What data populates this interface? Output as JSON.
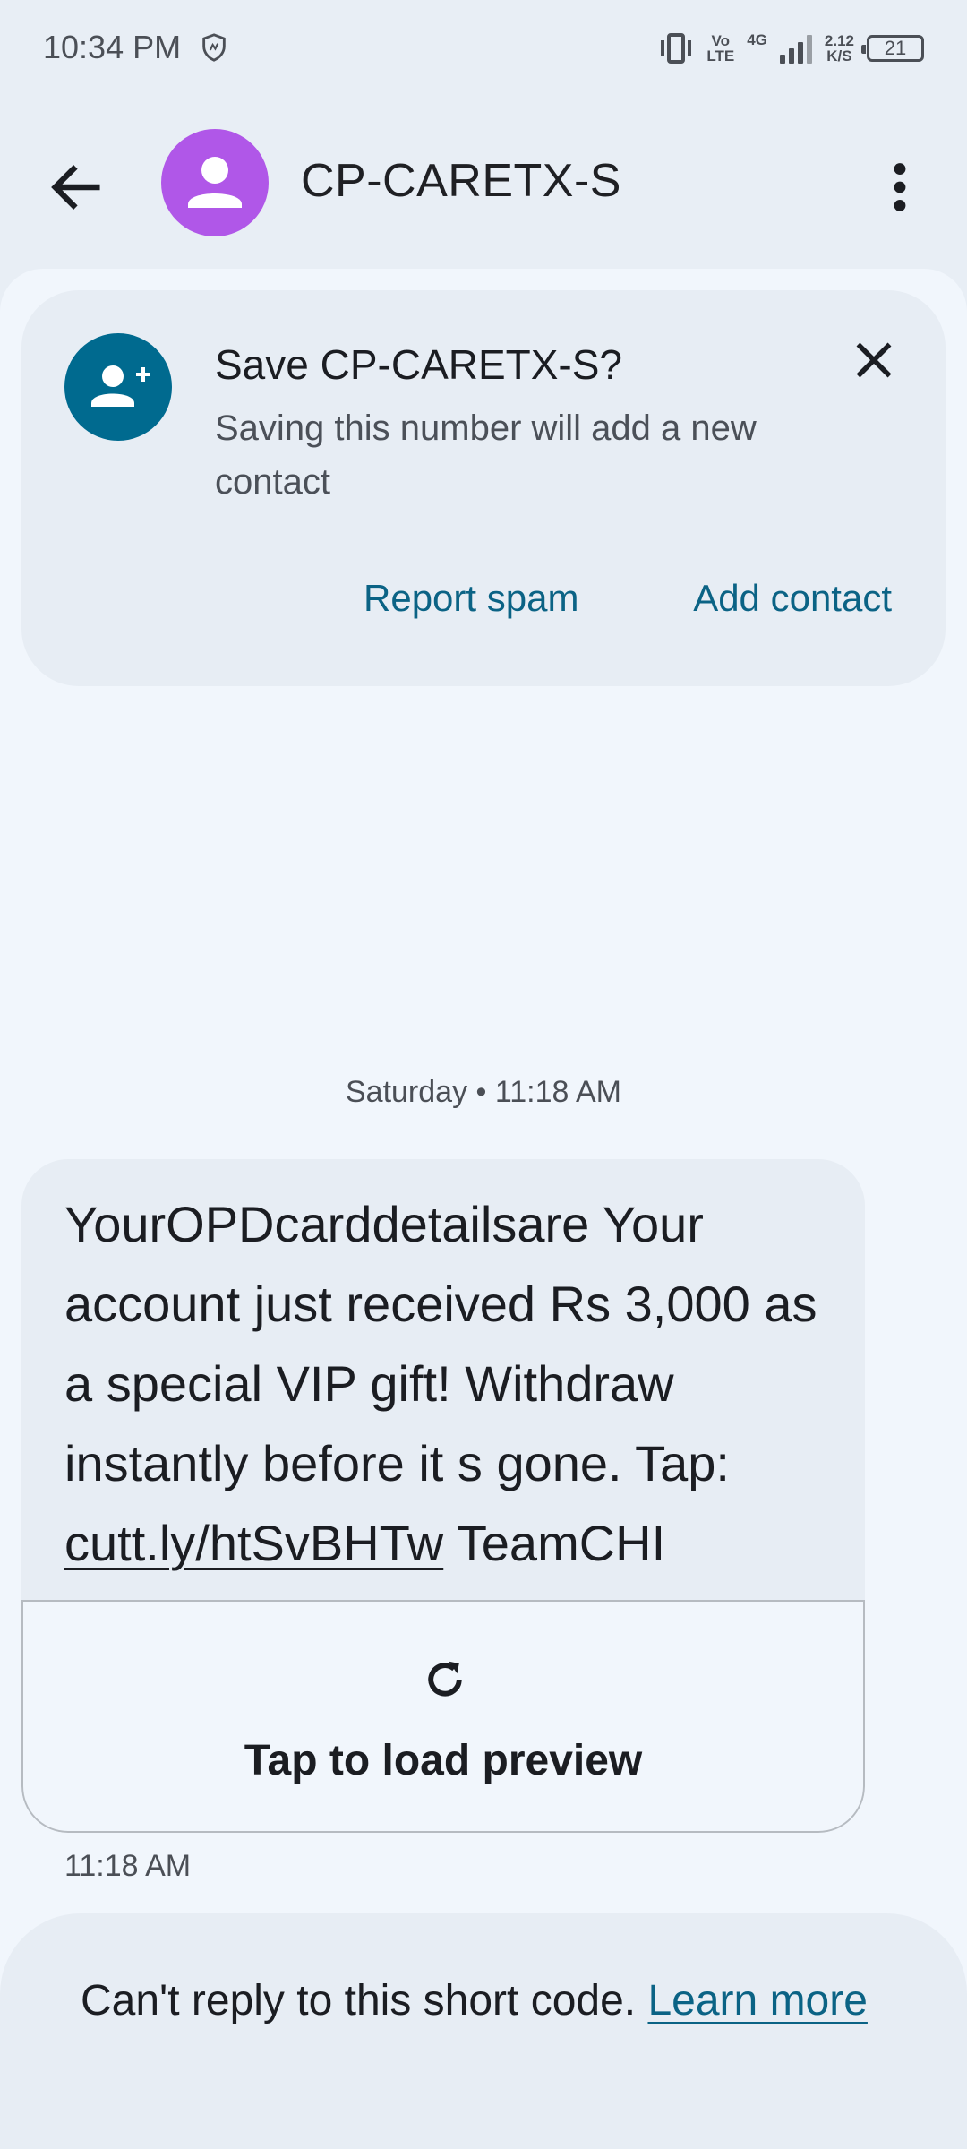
{
  "status_bar": {
    "time": "10:34 PM",
    "volte_top": "Vo",
    "volte_bottom": "LTE",
    "network": "4G",
    "speed_value": "2.12",
    "speed_unit": "K/S",
    "battery": "21"
  },
  "app_bar": {
    "contact_name": "CP-CARETX-S",
    "avatar_color": "#b057e8"
  },
  "save_card": {
    "title": "Save CP-CARETX-S?",
    "body": "Saving this number will add a new contact",
    "report_spam_label": "Report spam",
    "add_contact_label": "Add contact"
  },
  "conversation": {
    "date_separator": "Saturday • 11:18 AM",
    "message": {
      "text_before_link": "YourOPDcarddetailsare Your account just received Rs 3,000 as a special VIP gift! Withdraw instantly before it s gone. Tap: ",
      "link": "cutt.ly/htSvBHTw",
      "text_after_link": " TeamCHI",
      "preview_label": "Tap to load preview",
      "time": "11:18 AM"
    }
  },
  "notice": {
    "text": "Can't reply to this short code. ",
    "learn_more": "Learn more"
  },
  "colors": {
    "accent": "#0b6385",
    "background": "#f1f6fc",
    "card": "#e7edf4"
  }
}
